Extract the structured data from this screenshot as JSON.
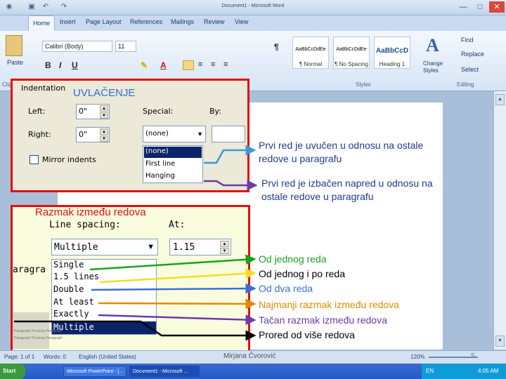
{
  "window": {
    "title": "Document1 - Microsoft Word",
    "minimize": "—",
    "maximize": "□",
    "close": "✕"
  },
  "tabs": [
    "Home",
    "Insert",
    "Page Layout",
    "References",
    "Mailings",
    "Review",
    "View"
  ],
  "ribbon": {
    "paste_label": "Paste",
    "font_name": "Calibri (Body)",
    "font_size": "11",
    "styles": [
      {
        "preview": "AaBbCcDdEe",
        "name": "¶ Normal"
      },
      {
        "preview": "AaBbCcDdEe",
        "name": "¶ No Spacing"
      },
      {
        "preview": "AaBbCcD",
        "name": "Heading 1"
      }
    ],
    "change_styles": "Change Styles",
    "find": "Find",
    "replace": "Replace",
    "select": "Select",
    "group_clipboard": "Clipbo",
    "group_styles": "Styles",
    "group_editing": "Editing"
  },
  "indentation_dialog": {
    "title": "Indentation",
    "heading": "UVLAČENJE",
    "left_label": "Left:",
    "left_value": "0\"",
    "right_label": "Right:",
    "right_value": "0\"",
    "special_label": "Special:",
    "special_value": "(none)",
    "by_label": "By:",
    "mirror_label": "Mirror indents",
    "special_options": [
      "(none)",
      "First line",
      "Hanging"
    ]
  },
  "spacing_dialog": {
    "heading": "Razmak između redova",
    "line_spacing_label": "Line spacing:",
    "at_label": "At:",
    "selected": "Multiple",
    "at_value": "1.15",
    "options": [
      "Single",
      "1.5 lines",
      "Double",
      "At least",
      "Exactly",
      "Multiple"
    ],
    "paragraph_partial": "aragra",
    "preview_lines": [
      "Paragraph Previous Paragraph",
      "Paragraph Previous Paragraph"
    ]
  },
  "annotations": {
    "first_line": "Prvi red je uvučen u odnosu na ostale redove u paragrafu",
    "hanging": "Prvi red je izbačen napred u odnosu na ostale redove u paragrafu",
    "spacing": [
      {
        "text": "Od jednog reda",
        "color": "#1aa31a"
      },
      {
        "text": "Od jednog i po reda",
        "color": "#000000"
      },
      {
        "text": "Od dva reda",
        "color": "#3a6fd0"
      },
      {
        "text": "Najmanji razmak između redova",
        "color": "#e08a00"
      },
      {
        "text": "Tačan razmak između redova",
        "color": "#6a3aa8"
      },
      {
        "text": "Prored od više redova",
        "color": "#000000"
      }
    ]
  },
  "status": {
    "page": "Page: 1 of 1",
    "words": "Words: 0",
    "language": "English (United States)",
    "author": "Mirjana Čvorović",
    "zoom": "120%",
    "slide_number": "5"
  },
  "taskbar": {
    "start": "Start",
    "items": [
      "Microsoft PowerPoint - [...",
      "Document1 - Microsoft ..."
    ],
    "lang": "EN",
    "time": "4:05 AM"
  },
  "colors": {
    "red_border": "#e01010",
    "blue_heading": "#2a6fd6",
    "annotation_text": "#1e3b8c"
  }
}
